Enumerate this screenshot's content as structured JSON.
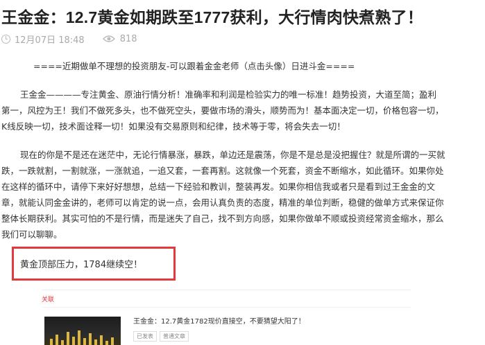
{
  "article": {
    "title": "王金金：12.7黄金如期跌至1777获利，大行情肉快煮熟了！",
    "date": "12月07日 18:48",
    "views": "818",
    "intro": "====近期做单不理想的投资朋友-可以跟着金金老师（点击头像）日进斗金====",
    "paragraphs": [
      [
        "王金金————专注黄金、原油行情分析！准确率和利润是检验实力的唯一标准！趋势投资，大道至简；盈利",
        "第一，风控为王！我们不做死多头，也不做死空头，要做市场的滑头，顺势而为！基本面决定一切，价格包容一切，",
        "K线反映一切，技术面诠释一切！如果没有交易原则和纪律，技术等于零，将会失去一切！"
      ],
      [
        "现在的你是不是还在迷茫中，无论行情暴涨，暴跌，单边还是震荡，你是不是总是没把握住？就是所谓的一买就",
        "跌，一跌就割，一割就涨，一涨就追，一追又套，一套再割。这就像一个死套，资金不断缩水，如此循环。如果你处",
        "在这样的循环中，请停下来好好想想，总结一下经验和教训，整装再发。如果你相信我或者只是看到过王金金的文",
        "章，就能认同金金讲的，老师可以肯定的说一点，会用认真负责的态度，精准的单位判断，稳健的做单方式来保证你",
        "整体长期获利。其实可怕的不是行情，而是迷失了自己，找不到方向感，如果你做单不顺或投资经常资金缩水，那么",
        "我们可以聊聊。"
      ]
    ],
    "highlight": "黄金顶部压力，1784继续空！"
  },
  "related": {
    "tag": "关联",
    "title": "王金金：12.7黄金1782现价直接空，不要猜望大阳了！",
    "tags": [
      "已发表",
      "普通文章"
    ]
  }
}
